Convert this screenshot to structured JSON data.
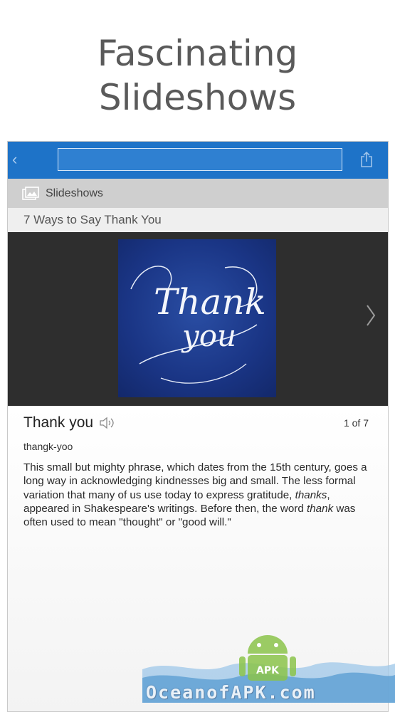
{
  "promo": {
    "line1": "Fascinating",
    "line2": "Slideshows"
  },
  "toolbar": {
    "back_glyph": "‹",
    "search_value": "",
    "share_icon": "share-icon"
  },
  "section": {
    "icon": "slideshow-icon",
    "label": "Slideshows"
  },
  "slideshow": {
    "title": "7 Ways to Say Thank You",
    "image_text_1": "Thank",
    "image_text_2": "you",
    "next_icon": "chevron-right-icon"
  },
  "entry": {
    "word": "Thank you",
    "counter": "1 of 7",
    "pronunciation": "thangk-yoo",
    "desc_1": "This small but mighty phrase, which dates from the 15th century, goes a long way in acknowledging kindnesses big and small. The less formal variation that many of us use today to express gratitude, ",
    "desc_2": "thanks",
    "desc_3": ", appeared in Shakespeare's writings. Before then, the word ",
    "desc_4": "thank",
    "desc_5": " was often used to mean \"thought\" or \"good will.\""
  },
  "watermark": {
    "text": "OceanofAPK.com",
    "badge": "APK"
  },
  "colors": {
    "topbar": "#1e73c8",
    "section": "#cfcfcf",
    "stage": "#2e2e2e",
    "card": "#1a3585"
  }
}
